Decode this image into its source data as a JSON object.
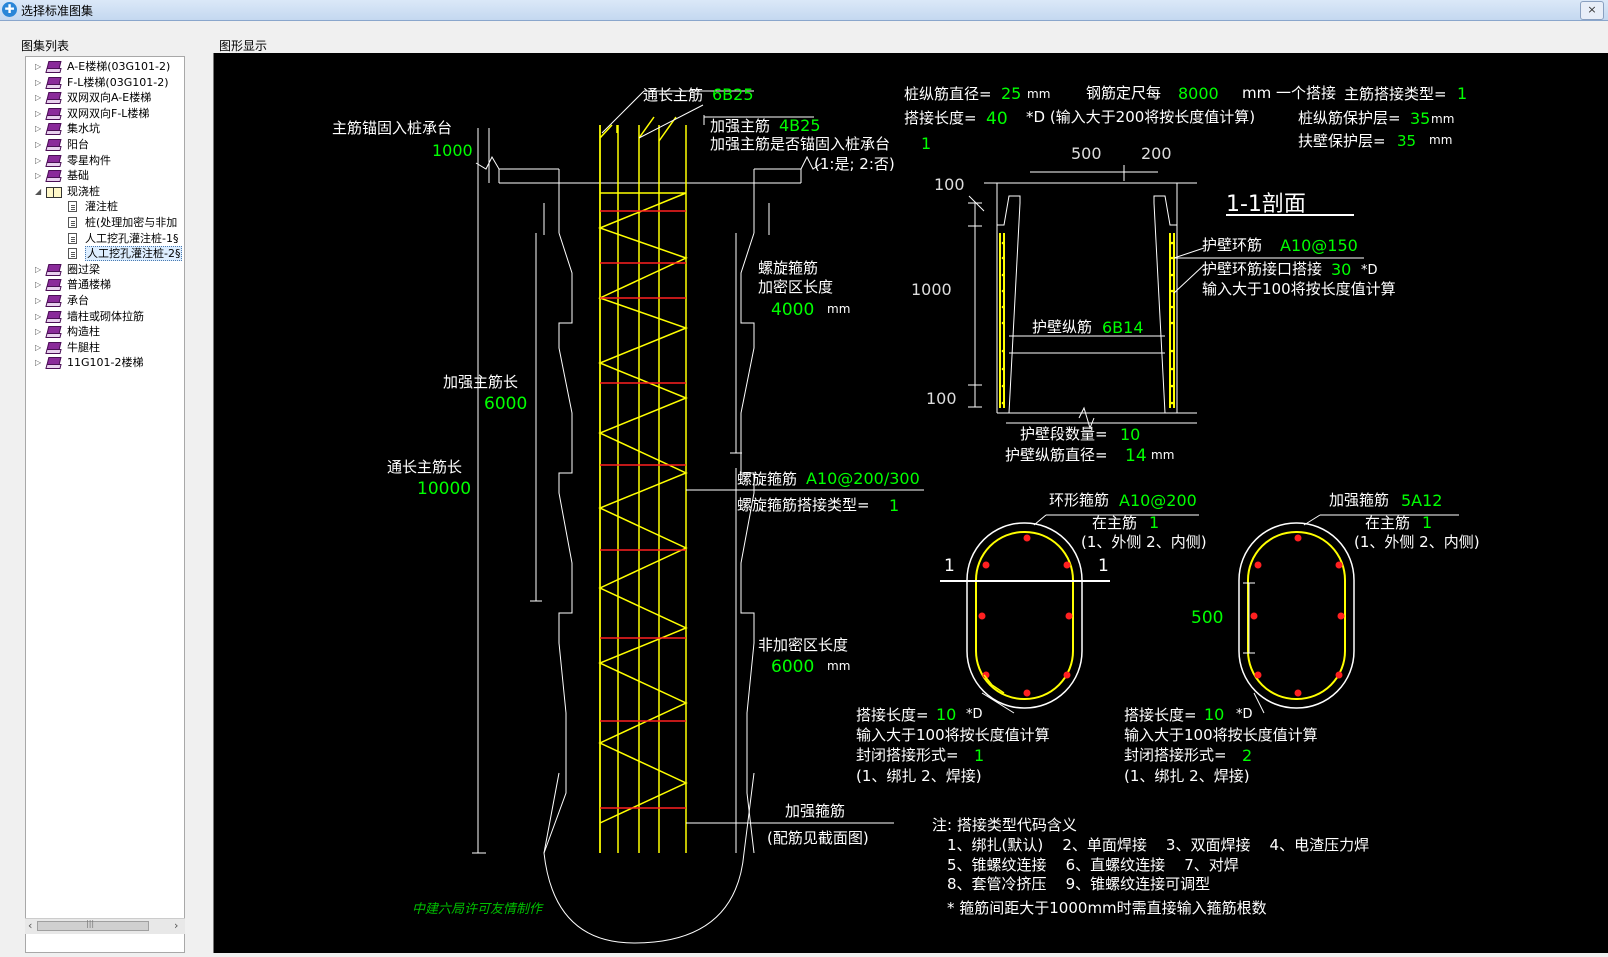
{
  "window": {
    "title": "选择标准图集",
    "icon": "app-logo-icon",
    "close_glyph": "×"
  },
  "tree_pane": {
    "label": "图集列表"
  },
  "drawing_pane": {
    "label": "图形显示"
  },
  "tree": [
    {
      "label": "A-E楼梯(03G101-2)",
      "level": 0,
      "type": "book"
    },
    {
      "label": "F-L楼梯(03G101-2)",
      "level": 0,
      "type": "book"
    },
    {
      "label": "双网双向A-E楼梯",
      "level": 0,
      "type": "book"
    },
    {
      "label": "双网双向F-L楼梯",
      "level": 0,
      "type": "book"
    },
    {
      "label": "集水坑",
      "level": 0,
      "type": "book"
    },
    {
      "label": "阳台",
      "level": 0,
      "type": "book"
    },
    {
      "label": "零星构件",
      "level": 0,
      "type": "book"
    },
    {
      "label": "基础",
      "level": 0,
      "type": "book"
    },
    {
      "label": "现浇桩",
      "level": 0,
      "type": "open-book",
      "expanded": true
    },
    {
      "label": "灌注桩",
      "level": 1,
      "type": "doc"
    },
    {
      "label": "桩(处理加密与非加",
      "level": 1,
      "type": "doc"
    },
    {
      "label": "人工挖孔灌注桩-1§",
      "level": 1,
      "type": "doc"
    },
    {
      "label": "人工挖孔灌注桩-2§",
      "level": 1,
      "type": "doc",
      "selected": true
    },
    {
      "label": "圈过梁",
      "level": 0,
      "type": "book"
    },
    {
      "label": "普通楼梯",
      "level": 0,
      "type": "book"
    },
    {
      "label": "承台",
      "level": 0,
      "type": "book"
    },
    {
      "label": "墙柱或砌体拉筋",
      "level": 0,
      "type": "book"
    },
    {
      "label": "构造柱",
      "level": 0,
      "type": "book"
    },
    {
      "label": "牛腿柱",
      "level": 0,
      "type": "book"
    },
    {
      "label": "11G101-2楼梯",
      "level": 0,
      "type": "book"
    }
  ],
  "scroll": {
    "left": "‹",
    "right": "›",
    "thumb": "|||"
  },
  "colors": {
    "background": "#000000",
    "text": "#ffffff",
    "value": "#00ff00",
    "rebar": "#ffff00",
    "stirrup": "#ff2020",
    "outline": "#ffffff",
    "credit": "#00c000"
  },
  "drawing": {
    "elevation": {
      "through_bar_label": "通长主筋",
      "through_bar_value": "6B25",
      "anchor_label": "主筋锚固入桩承台",
      "anchor_value": "1000",
      "strengthen_bar_label": "加强主筋",
      "strengthen_bar_value": "4B25",
      "anchor_choice_label": "加强主筋是否锚固入桩承台",
      "anchor_choice_value": "1",
      "anchor_choice_hint": "(1:是; 2:否)",
      "spiral_label": "螺旋箍筋",
      "dense_zone_label": "加密区长度",
      "dense_zone_value": "4000",
      "unit_mm": "mm",
      "strengthen_len_label": "加强主筋长",
      "strengthen_len_value": "6000",
      "through_len_label": "通长主筋长",
      "through_len_value": "10000",
      "spiral_spec_label": "螺旋箍筋",
      "spiral_spec_value": "A10@200/300",
      "spiral_lap_label": "螺旋箍筋搭接类型=",
      "spiral_lap_value": "1",
      "sparse_zone_label": "非加密区长度",
      "sparse_zone_value": "6000",
      "ring_label": "加强箍筋",
      "ring_hint": "(配筋见截面图)",
      "credit": "中建六局许可友情制作"
    },
    "params": {
      "pile_dia_label": "桩纵筋直径=",
      "pile_dia_value": "25",
      "pile_dia_unit": "mm",
      "fixed_len_label": "钢筋定尺每",
      "fixed_len_value": "8000",
      "fixed_len_unit": "mm 一个搭接",
      "lap_type_label": "主筋搭接类型=",
      "lap_type_value": "1",
      "lap_len_label": "搭接长度=",
      "lap_len_value": "40",
      "lap_len_hint": "*D (输入大于200将按长度值计算)",
      "cover_label": "桩纵筋保护层=",
      "cover_value": "35",
      "cover_unit": "mm",
      "wall_cover_label": "扶壁保护层=",
      "wall_cover_value": "35",
      "wall_cover_unit": "mm"
    },
    "section": {
      "title": "1-1剖面",
      "dim_top_left": "500",
      "dim_top_right": "200",
      "dim_100_top": "100",
      "dim_1000": "1000",
      "dim_100_bottom": "100",
      "ring_bar_label": "护壁环筋",
      "ring_bar_value": "A10@150",
      "ring_lap_label": "护壁环筋接口搭接",
      "ring_lap_value": "30",
      "ring_lap_unit": "*D",
      "ring_lap_hint": "输入大于100将按长度值计算",
      "long_bar_label": "护壁纵筋",
      "long_bar_value": "6B14",
      "segments_label": "护壁段数量=",
      "segments_value": "10",
      "long_dia_label": "护壁纵筋直径=",
      "long_dia_value": "14",
      "long_dia_unit": "mm"
    },
    "plan_left": {
      "stirrup_label": "环形箍筋",
      "stirrup_value": "A10@200",
      "position_label": "在主筋",
      "position_value": "1",
      "position_hint": "(1、外侧  2、内侧)",
      "cut_mark": "1",
      "lap_label": "搭接长度=",
      "lap_value": "10",
      "lap_unit": "*D",
      "lap_hint": "输入大于100将按长度值计算",
      "close_label": "封闭搭接形式=",
      "close_value": "1",
      "close_hint": "(1、绑扎  2、焊接)"
    },
    "plan_right": {
      "stirrup_label": "加强箍筋",
      "stirrup_value": "5A12",
      "position_label": "在主筋",
      "position_value": "1",
      "position_hint": "(1、外侧  2、内侧)",
      "dim": "500",
      "lap_label": "搭接长度=",
      "lap_value": "10",
      "lap_unit": "*D",
      "lap_hint": "输入大于100将按长度值计算",
      "close_label": "封闭搭接形式=",
      "close_value": "2",
      "close_hint": "(1、绑扎  2、焊接)"
    },
    "notes": {
      "title": "注: 搭接类型代码含义",
      "line1": "1、绑扎(默认)    2、单面焊接    3、双面焊接    4、电渣压力焊",
      "line2": "5、锥螺纹连接    6、直螺纹连接    7、对焊",
      "line3": "8、套管冷挤压    9、锥螺纹连接可调型",
      "line4": "* 箍筋间距大于1000mm时需直接输入箍筋根数"
    }
  }
}
